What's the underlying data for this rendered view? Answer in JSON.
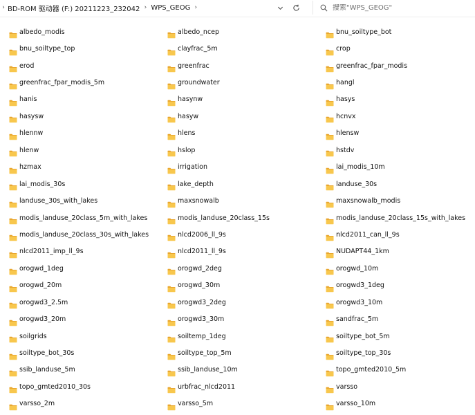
{
  "breadcrumb": {
    "segments": [
      "BD-ROM 驱动器 (F:) 20211223_232042",
      "WPS_GEOG"
    ]
  },
  "search": {
    "placeholder": "搜索\"WPS_GEOG\""
  },
  "icons": {
    "folder": "folder-icon",
    "refresh": "refresh-icon",
    "dropdown": "chevron-down-icon",
    "search": "search-icon",
    "separator": "chevron-right-icon"
  },
  "colors": {
    "folder_body": "#F8C74D",
    "folder_tab": "#E9A72F"
  },
  "folders": [
    "albedo_modis",
    "albedo_ncep",
    "bnu_soiltype_bot",
    "bnu_soiltype_top",
    "clayfrac_5m",
    "crop",
    "erod",
    "greenfrac",
    "greenfrac_fpar_modis",
    "greenfrac_fpar_modis_5m",
    "groundwater",
    "hangl",
    "hanis",
    "hasynw",
    "hasys",
    "hasysw",
    "hasyw",
    "hcnvx",
    "hlennw",
    "hlens",
    "hlensw",
    "hlenw",
    "hslop",
    "hstdv",
    "hzmax",
    "irrigation",
    "lai_modis_10m",
    "lai_modis_30s",
    "lake_depth",
    "landuse_30s",
    "landuse_30s_with_lakes",
    "maxsnowalb",
    "maxsnowalb_modis",
    "modis_landuse_20class_5m_with_lakes",
    "modis_landuse_20class_15s",
    "modis_landuse_20class_15s_with_lakes",
    "modis_landuse_20class_30s_with_lakes",
    "nlcd2006_ll_9s",
    "nlcd2011_can_ll_9s",
    "nlcd2011_imp_ll_9s",
    "nlcd2011_ll_9s",
    "NUDAPT44_1km",
    "orogwd_1deg",
    "orogwd_2deg",
    "orogwd_10m",
    "orogwd_20m",
    "orogwd_30m",
    "orogwd3_1deg",
    "orogwd3_2.5m",
    "orogwd3_2deg",
    "orogwd3_10m",
    "orogwd3_20m",
    "orogwd3_30m",
    "sandfrac_5m",
    "soilgrids",
    "soiltemp_1deg",
    "soiltype_bot_5m",
    "soiltype_bot_30s",
    "soiltype_top_5m",
    "soiltype_top_30s",
    "ssib_landuse_5m",
    "ssib_landuse_10m",
    "topo_gmted2010_5m",
    "topo_gmted2010_30s",
    "urbfrac_nlcd2011",
    "varsso",
    "varsso_2m",
    "varsso_5m",
    "varsso_10m"
  ]
}
